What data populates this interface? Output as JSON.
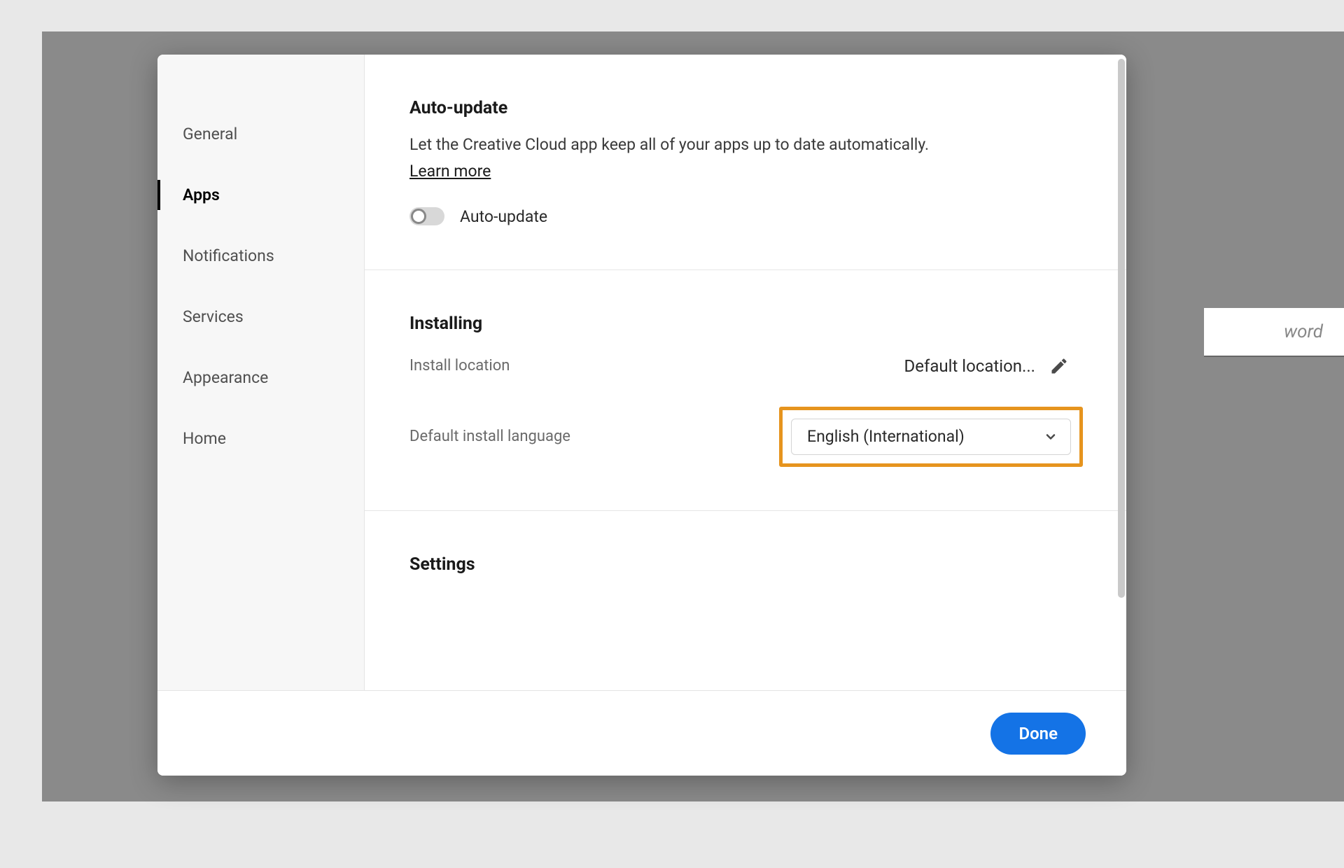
{
  "background": {
    "partial_text": "word"
  },
  "sidebar": {
    "items": [
      {
        "label": "General",
        "active": false
      },
      {
        "label": "Apps",
        "active": true
      },
      {
        "label": "Notifications",
        "active": false
      },
      {
        "label": "Services",
        "active": false
      },
      {
        "label": "Appearance",
        "active": false
      },
      {
        "label": "Home",
        "active": false
      }
    ]
  },
  "sections": {
    "auto_update": {
      "title": "Auto-update",
      "description": "Let the Creative Cloud app keep all of your apps up to date automatically.",
      "learn_more": "Learn more",
      "toggle_label": "Auto-update",
      "toggle_on": false
    },
    "installing": {
      "title": "Installing",
      "install_location_label": "Install location",
      "install_location_value": "Default location...",
      "default_language_label": "Default install language",
      "default_language_value": "English (International)"
    },
    "settings": {
      "title": "Settings"
    }
  },
  "footer": {
    "done": "Done"
  }
}
